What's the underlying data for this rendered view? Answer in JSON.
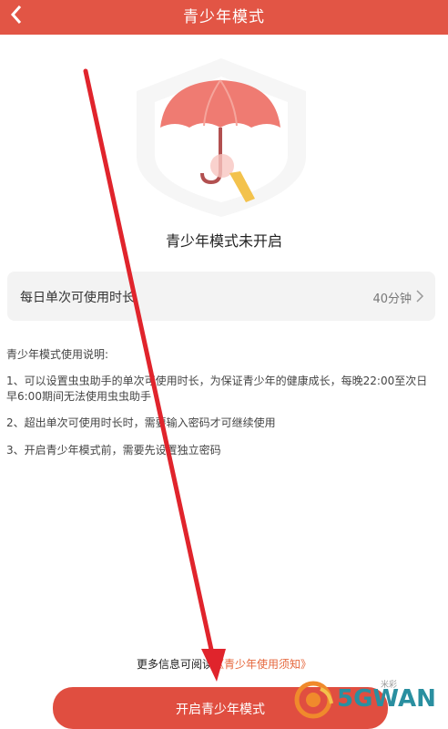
{
  "header": {
    "title": "青少年模式"
  },
  "status_text": "青少年模式未开启",
  "limit": {
    "label": "每日单次可使用时长",
    "value": "40分钟"
  },
  "instructions": {
    "title": "青少年模式使用说明:",
    "items": [
      "1、可以设置虫虫助手的单次可使用时长，为保证青少年的健康成长，每晚22:00至次日早6:00期间无法使用虫虫助手",
      "2、超出单次可使用时长时，需要输入密码才可继续使用",
      "3、开启青少年模式前，需要先设置独立密码"
    ]
  },
  "footer": {
    "prefix": "更多信息可阅读",
    "link": "《青少年使用须知》"
  },
  "start_button": "开启青少年模式",
  "watermark": {
    "text": "5GWAN",
    "small": "米彩"
  },
  "colors": {
    "accent": "#e25545",
    "button": "#e04e40",
    "link": "#e6673c",
    "annotation_arrow": "#e0242c"
  }
}
